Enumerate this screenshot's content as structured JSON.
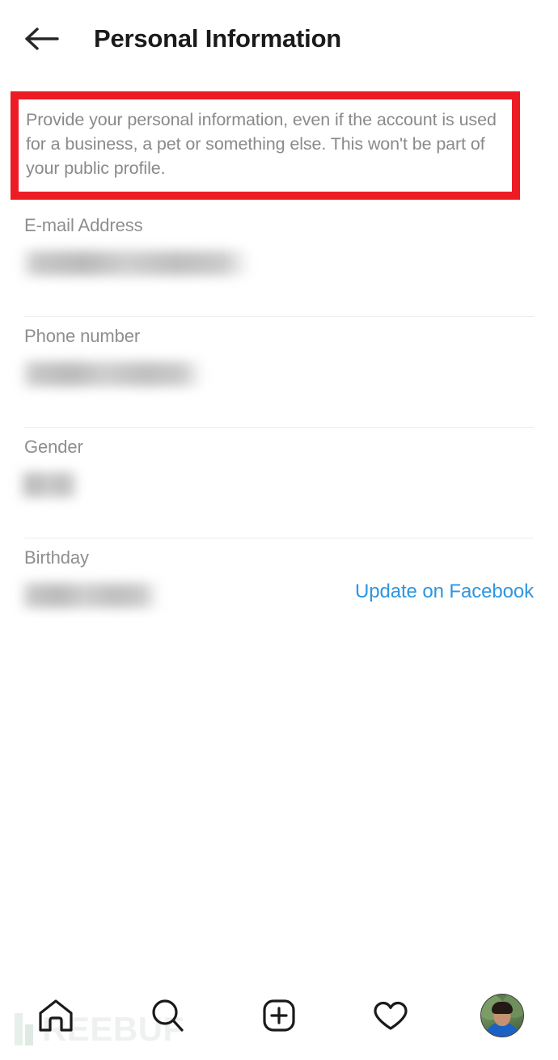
{
  "header": {
    "title": "Personal Information",
    "back_icon": "arrow-left-icon"
  },
  "annotation": {
    "color": "#ed1c24",
    "description": "Provide your personal information, even if the account is used for a business, a pet or something else. This won't be part of your public profile."
  },
  "fields": [
    {
      "label": "E-mail Address",
      "value": "",
      "value_redacted": true,
      "blur_width": 285
    },
    {
      "label": "Phone number",
      "value": "",
      "value_redacted": true,
      "blur_width": 227
    },
    {
      "label": "Gender",
      "value": "",
      "value_redacted": true,
      "blur_width": 72
    },
    {
      "label": "Birthday",
      "value": "",
      "value_redacted": true,
      "blur_width": 172,
      "action_label": "Update on Facebook",
      "action_color": "#2e95e0"
    }
  ],
  "watermark": {
    "text": "REEBUF",
    "mark": "freebuf-logo-icon"
  },
  "bottom_nav": {
    "items": [
      {
        "icon": "home-icon",
        "label": "Home"
      },
      {
        "icon": "search-icon",
        "label": "Search"
      },
      {
        "icon": "add-post-icon",
        "label": "New Post"
      },
      {
        "icon": "heart-icon",
        "label": "Activity"
      },
      {
        "icon": "profile-avatar",
        "label": "Profile"
      }
    ]
  }
}
